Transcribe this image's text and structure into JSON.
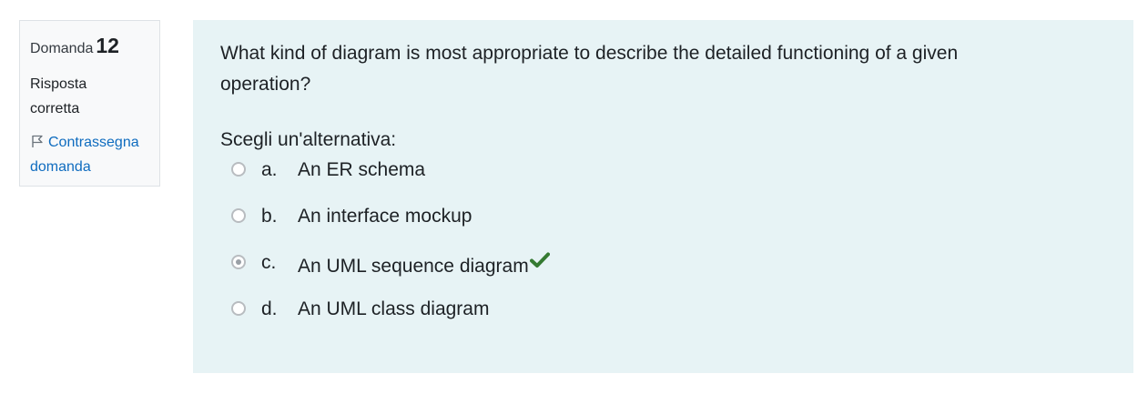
{
  "info": {
    "question_label": "Domanda",
    "question_number": "12",
    "state_line1": "Risposta",
    "state_line2": "corretta",
    "flag_line1": "Contrassegna",
    "flag_line2": "domanda",
    "flag_icon": "flag-icon",
    "link_color": "#0f6cbf"
  },
  "question": {
    "text_line1": "What kind of diagram is most appropriate to describe the detailed functioning of a given",
    "text_line2": "operation?",
    "prompt": "Scegli un'alternativa:",
    "selected": "c",
    "correct": "c",
    "correct_icon": "check-icon",
    "correct_color": "#357a32",
    "answers": [
      {
        "letter": "a.",
        "text": "An ER schema",
        "checked": false
      },
      {
        "letter": "b.",
        "text": "An interface mockup",
        "checked": false
      },
      {
        "letter": "c.",
        "text": "An UML sequence diagram",
        "checked": true
      },
      {
        "letter": "d.",
        "text": "An UML class diagram",
        "checked": false
      }
    ]
  }
}
